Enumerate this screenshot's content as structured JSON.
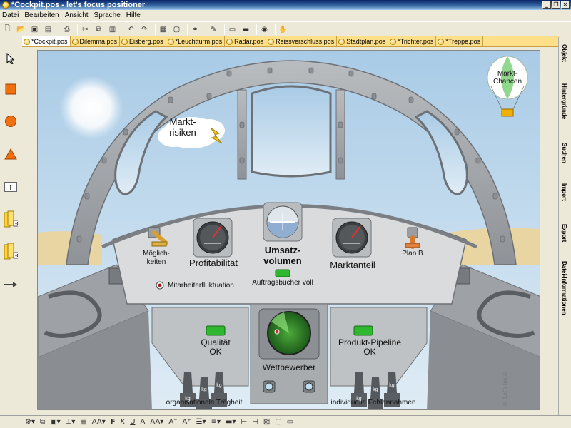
{
  "window": {
    "title": "*Cockpit.pos - let's focus positioner"
  },
  "menu": [
    "Datei",
    "Bearbeiten",
    "Ansicht",
    "Sprache",
    "Hilfe"
  ],
  "tabs": [
    {
      "label": "*Cockpit.pos",
      "active": true
    },
    {
      "label": "Dilemma.pos"
    },
    {
      "label": "Eisberg.pos"
    },
    {
      "label": "*Leuchtturm.pos"
    },
    {
      "label": "Radar.pos"
    },
    {
      "label": "Reissverschluss.pos"
    },
    {
      "label": "Stadtplan.pos"
    },
    {
      "label": "*Trichter.pos"
    },
    {
      "label": "*Treppe.pos"
    }
  ],
  "right_panel": [
    "Objekt",
    "Hintergründe",
    "Suchen",
    "Import",
    "Export",
    "Datei-Informationen"
  ],
  "canvas": {
    "balloon": "Markt-\nChancen",
    "cloud": "Markt-\nrisiken",
    "switch_left": "Möglich-\nkeiten",
    "gauge_left": "Profitabilität",
    "center_title": "Umsatz-\nvolumen",
    "center_led": "Auftragsbücher voll",
    "gauge_right": "Marktanteil",
    "switch_right": "Plan B",
    "radio": "Mitarbeiterfluktuation",
    "quality": "Qualität\nOK",
    "radar": "Wettbewerber",
    "pipeline": "Produkt-Pipeline\nOK",
    "inertia": "organisationale Trägheit",
    "errors": "individuelle Fehlannahmen",
    "weight": "kg",
    "watermark": "© Let's focus"
  },
  "colors": {
    "accent_tab": "#ffe08a",
    "led_green": "#2fb82f"
  }
}
